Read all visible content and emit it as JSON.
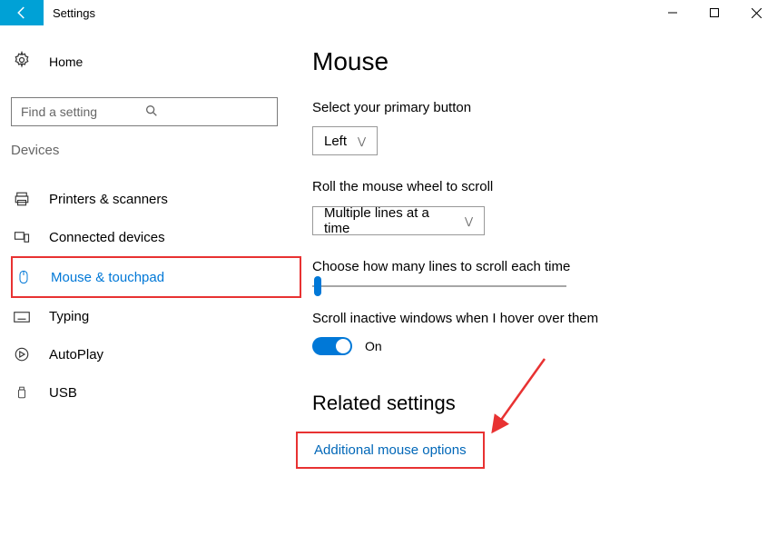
{
  "window": {
    "title": "Settings"
  },
  "home_label": "Home",
  "search": {
    "placeholder": "Find a setting"
  },
  "category": "Devices",
  "nav": [
    {
      "icon": "printer-icon",
      "label": "Printers & scanners"
    },
    {
      "icon": "devices-icon",
      "label": "Connected devices"
    },
    {
      "icon": "mouse-icon",
      "label": "Mouse & touchpad"
    },
    {
      "icon": "keyboard-icon",
      "label": "Typing"
    },
    {
      "icon": "autoplay-icon",
      "label": "AutoPlay"
    },
    {
      "icon": "usb-icon",
      "label": "USB"
    }
  ],
  "page": {
    "title": "Mouse",
    "primary_label": "Select your primary button",
    "primary_value": "Left",
    "wheel_label": "Roll the mouse wheel to scroll",
    "wheel_value": "Multiple lines at a time",
    "lines_label": "Choose how many lines to scroll each time",
    "inactive_label": "Scroll inactive windows when I hover over them",
    "toggle_state": "On",
    "related_heading": "Related settings",
    "link_additional": "Additional mouse options"
  }
}
